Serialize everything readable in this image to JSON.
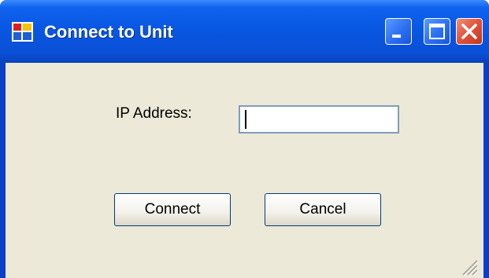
{
  "window": {
    "title": "Connect to Unit",
    "controls": [
      "minimize-icon",
      "maximize-icon",
      "close-icon"
    ]
  },
  "form": {
    "ip_label": "IP Address:",
    "ip_value": "",
    "connect_label": "Connect",
    "cancel_label": "Cancel"
  },
  "colors": {
    "titlebar": "#0a55e0",
    "client_bg": "#ece9d8",
    "close_button": "#e0523a"
  }
}
